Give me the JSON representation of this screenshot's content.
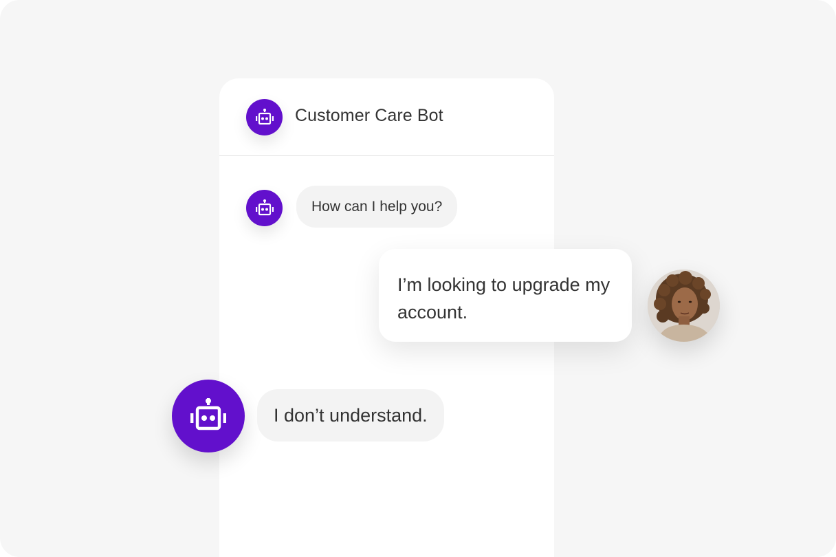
{
  "chat": {
    "header": {
      "title": "Customer Care Bot",
      "avatar_icon": "robot-icon"
    },
    "messages": [
      {
        "sender": "bot",
        "text": "How can I help you?"
      },
      {
        "sender": "user",
        "text": "I’m looking to upgrade my account."
      },
      {
        "sender": "bot",
        "text": "I don’t understand."
      }
    ]
  },
  "colors": {
    "accent": "#6210cc",
    "bubble_bot": "#f3f3f3",
    "text": "#333333",
    "background": "#f6f6f6"
  }
}
